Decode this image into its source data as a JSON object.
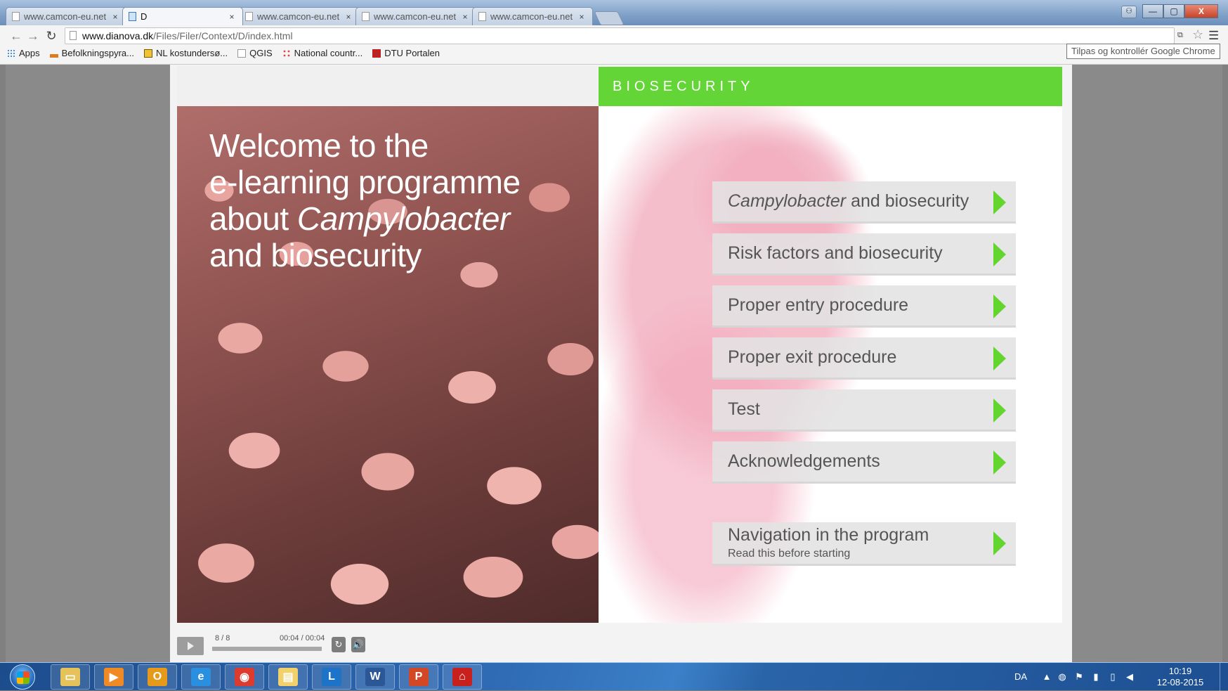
{
  "browser": {
    "tabs": [
      {
        "label": "www.camcon-eu.net",
        "active": false
      },
      {
        "label": "D",
        "active": true
      },
      {
        "label": "www.camcon-eu.net",
        "active": false
      },
      {
        "label": "www.camcon-eu.net",
        "active": false
      },
      {
        "label": "www.camcon-eu.net",
        "active": false
      }
    ],
    "tab_close_glyph": "×",
    "window_controls": {
      "minimize": "—",
      "maximize": "▢",
      "close": "X"
    },
    "url_host": "www.dianova.dk",
    "url_path": "/Files/Filer/Context/D/index.html",
    "bookmarks": [
      {
        "label": "Apps",
        "icon": "apps-grid-icon",
        "color": "#3b7dd8"
      },
      {
        "label": "Befolkningspyra...",
        "icon": "bar-chart-icon",
        "color": "#e07b1a"
      },
      {
        "label": "NL kostundersø...",
        "icon": "bookmark-yellow-icon",
        "color": "#f1c232"
      },
      {
        "label": "QGIS",
        "icon": "page-icon",
        "color": "#ffffff"
      },
      {
        "label": "National countr...",
        "icon": "dots-icon",
        "color": "#d44"
      },
      {
        "label": "DTU Portalen",
        "icon": "dtu-icon",
        "color": "#b22"
      }
    ],
    "tooltip": "Tilpas og kontrollér Google Chrome"
  },
  "course": {
    "banner_title": "BIOSECURITY",
    "welcome_lines": [
      "Welcome to the",
      "e-learning programme"
    ],
    "welcome_about": "about ",
    "welcome_italic": "Campylobacter",
    "welcome_last": "and biosecurity",
    "menu": {
      "item1_italic": "Campylobacter",
      "item1_rest": " and biosecurity",
      "item2": "Risk factors and biosecurity",
      "item3": "Proper entry procedure",
      "item4": "Proper exit procedure",
      "item5": "Test",
      "item6": "Acknowledgements",
      "nav_title": "Navigation in the program",
      "nav_sub": "Read this before starting"
    },
    "accent_color": "#64d536"
  },
  "player": {
    "slide_counter": "8 / 8",
    "time": "00:04 / 00:04",
    "progress": 1.0,
    "replay_glyph": "↻",
    "volume_glyph": "🔊"
  },
  "taskbar": {
    "apps": [
      {
        "name": "explorer",
        "glyph": "▭",
        "color": "#e6c35a"
      },
      {
        "name": "media-player",
        "glyph": "▶",
        "color": "#f08a24"
      },
      {
        "name": "outlook",
        "glyph": "O",
        "color": "#e69a1c"
      },
      {
        "name": "internet-explorer",
        "glyph": "e",
        "color": "#2b8fe0"
      },
      {
        "name": "chrome",
        "glyph": "◉",
        "color": "#dc3b2e"
      },
      {
        "name": "folder",
        "glyph": "▤",
        "color": "#f2d16b"
      },
      {
        "name": "lync",
        "glyph": "L",
        "color": "#1d73c8"
      },
      {
        "name": "word",
        "glyph": "W",
        "color": "#2b5797"
      },
      {
        "name": "powerpoint",
        "glyph": "P",
        "color": "#d24726"
      },
      {
        "name": "acrobat",
        "glyph": "⌂",
        "color": "#c8201c"
      }
    ],
    "language": "DA",
    "clock_time": "10:19",
    "clock_date": "12-08-2015"
  }
}
